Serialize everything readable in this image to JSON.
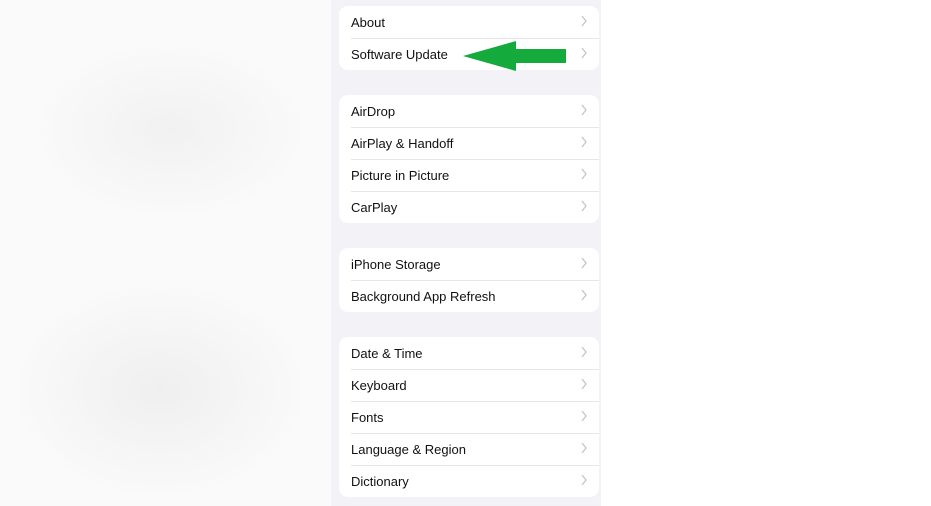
{
  "groups": [
    {
      "items": [
        {
          "label": "About"
        },
        {
          "label": "Software Update"
        }
      ]
    },
    {
      "items": [
        {
          "label": "AirDrop"
        },
        {
          "label": "AirPlay & Handoff"
        },
        {
          "label": "Picture in Picture"
        },
        {
          "label": "CarPlay"
        }
      ]
    },
    {
      "items": [
        {
          "label": "iPhone Storage"
        },
        {
          "label": "Background App Refresh"
        }
      ]
    },
    {
      "items": [
        {
          "label": "Date & Time"
        },
        {
          "label": "Keyboard"
        },
        {
          "label": "Fonts"
        },
        {
          "label": "Language & Region"
        },
        {
          "label": "Dictionary"
        }
      ]
    }
  ],
  "annotation": {
    "icon": "arrow-left-icon",
    "color": "#14aa3c",
    "points_to": "Software Update"
  },
  "colors": {
    "background": "#f2f2f7",
    "card": "#ffffff",
    "chevron": "#c4c4c7"
  }
}
